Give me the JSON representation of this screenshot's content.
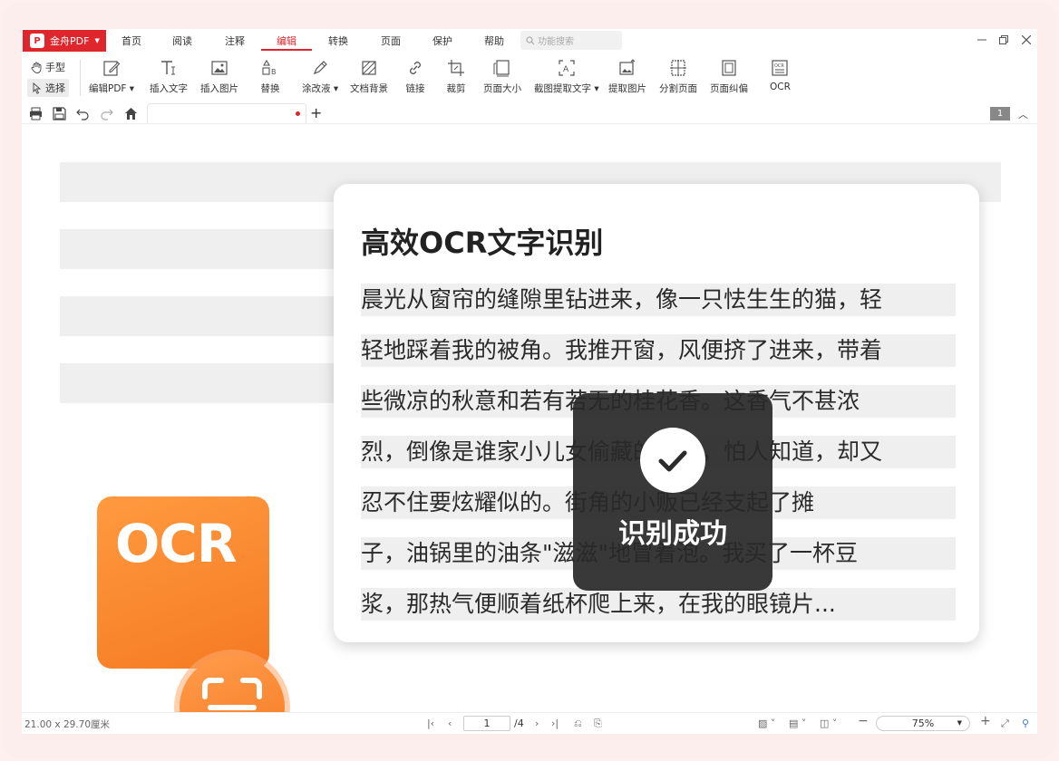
{
  "app": {
    "brand": "金舟PDF"
  },
  "menu": {
    "items": [
      "首页",
      "阅读",
      "注释",
      "编辑",
      "转换",
      "页面",
      "保护",
      "帮助"
    ],
    "search_placeholder": "功能搜索"
  },
  "ribbon": {
    "modes": [
      "手型",
      "选择"
    ],
    "tools": [
      "编辑PDF",
      "插入文字",
      "插入图片",
      "替换",
      "涂改液",
      "文档背景",
      "链接",
      "裁剪",
      "页面大小",
      "截图提取文字",
      "提取图片",
      "分割页面",
      "页面纠偏",
      "OCR"
    ]
  },
  "tabrow": {
    "page_badge": "1"
  },
  "ocr_icon": {
    "text": "OCR"
  },
  "card": {
    "title": "高效OCR文字识别",
    "lines": [
      "晨光从窗帘的缝隙里钻进来，像一只怯生生的猫，轻",
      "轻地踩着我的被角。我推开窗，风便挤了进来，带着",
      "些微凉的秋意和若有若无的桂花香。这香气不甚浓",
      "烈，倒像是谁家小儿女偷藏的糖块，怕人知道，却又",
      "忍不住要炫耀似的。街角的小贩已经支起了摊",
      "子，油锅里的油条\"滋滋\"地冒着泡。我买了一杯豆",
      "浆，那热气便顺着纸杯爬上来，在我的眼镜片..."
    ]
  },
  "toast": {
    "message": "识别成功"
  },
  "statusbar": {
    "page_size": "21.00 x 29.70厘米",
    "current_page": "1",
    "total_pages": "/4",
    "zoom": "75%"
  },
  "colors": {
    "accent": "#e0262d",
    "ocr_orange": "#f57a22"
  }
}
